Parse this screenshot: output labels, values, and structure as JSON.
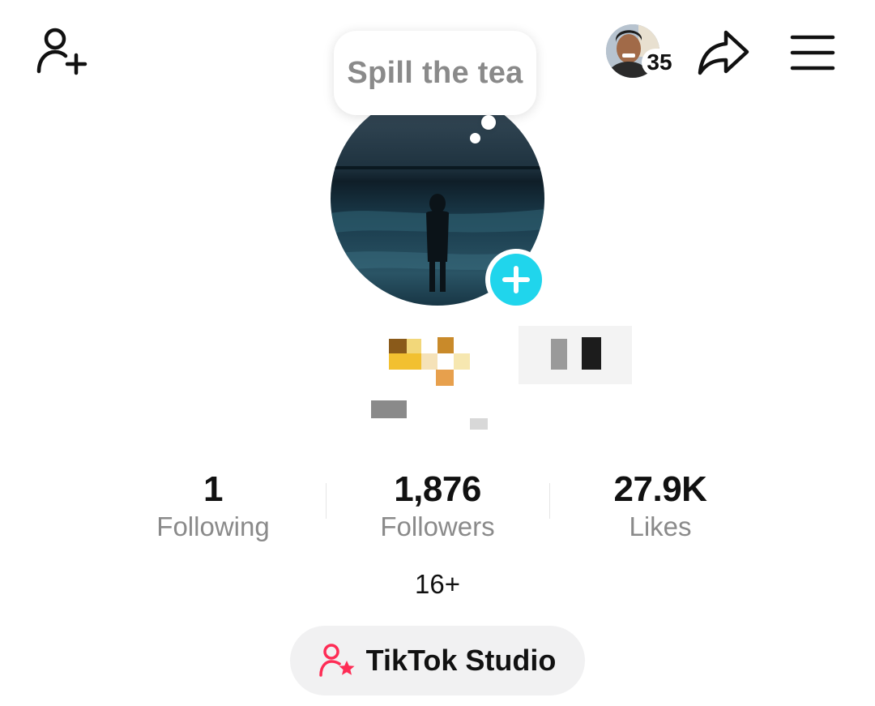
{
  "header": {
    "story_count": "35",
    "speech_bubble": "Spill the tea"
  },
  "stats": [
    {
      "value": "1",
      "label": "Following"
    },
    {
      "value": "1,876",
      "label": "Followers"
    },
    {
      "value": "27.9K",
      "label": "Likes"
    }
  ],
  "age_rating": "16+",
  "studio_button": {
    "label": "TikTok Studio"
  },
  "icons": {
    "add_friend": "person-plus-icon",
    "share": "share-arrow-icon",
    "menu": "hamburger-menu-icon",
    "avatar_add": "plus-icon",
    "studio": "person-star-icon"
  },
  "colors": {
    "accent_cyan": "#20d5ec",
    "studio_pink": "#fe2c55",
    "muted_text": "#8a8a8a"
  }
}
